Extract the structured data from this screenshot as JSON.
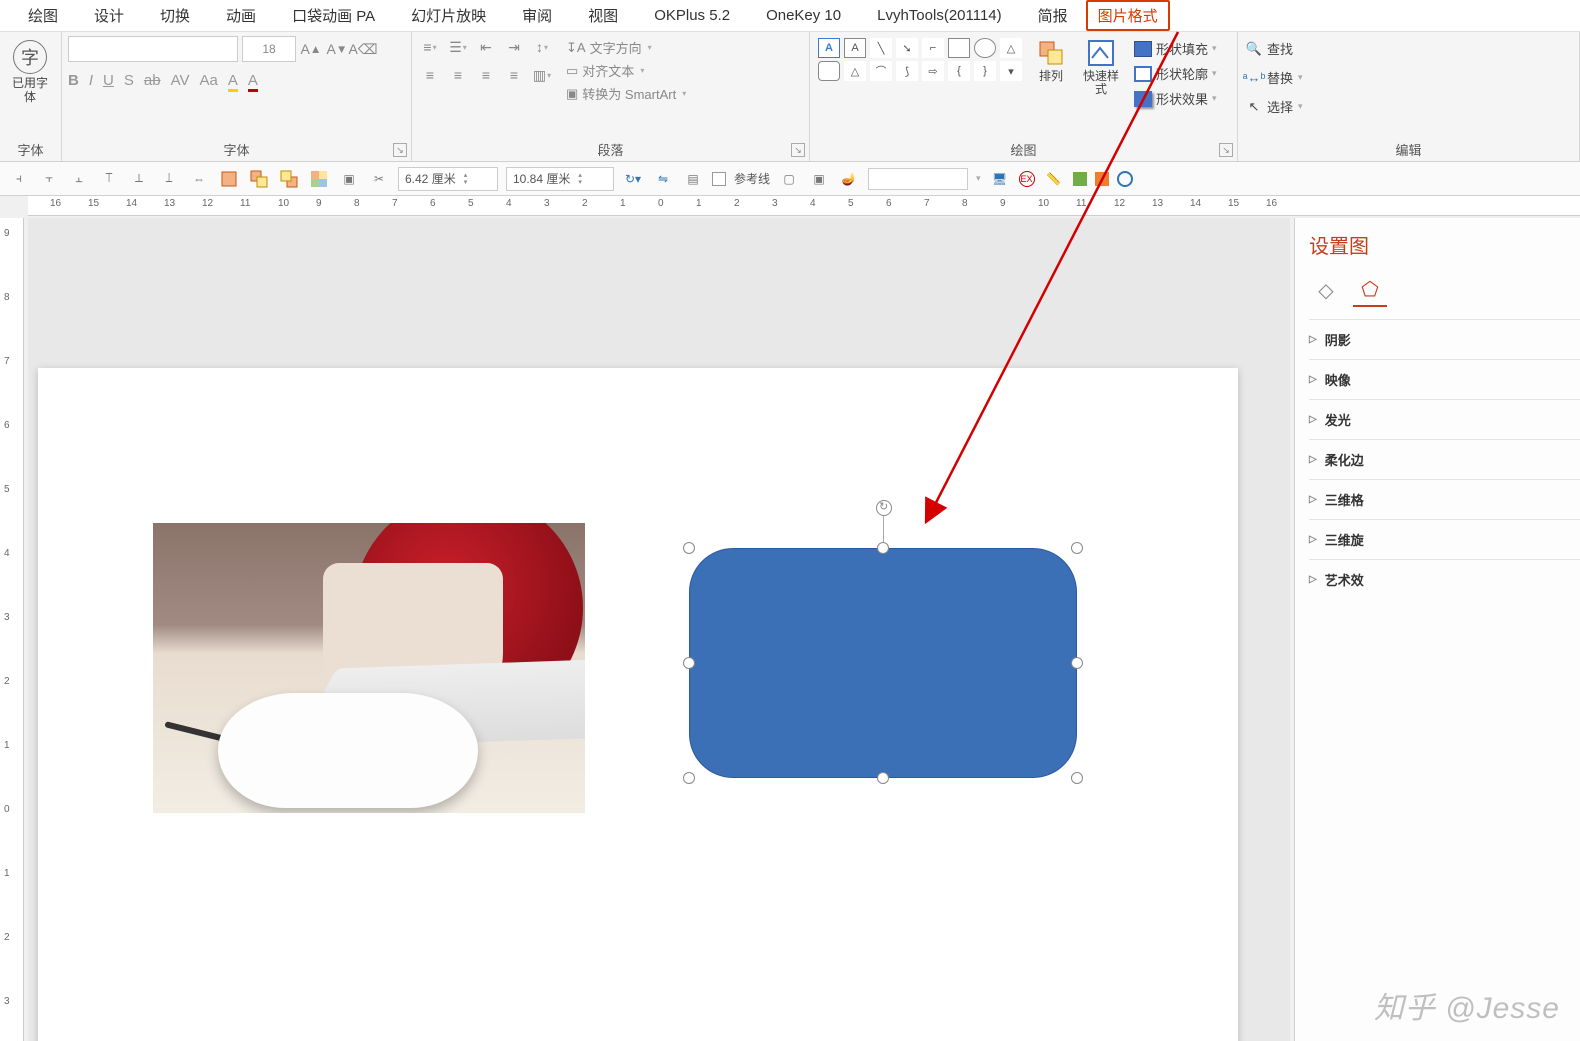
{
  "tabs": {
    "items": [
      "绘图",
      "设计",
      "切换",
      "动画",
      "口袋动画 PA",
      "幻灯片放映",
      "审阅",
      "视图",
      "OKPlus 5.2",
      "OneKey 10",
      "LvyhTools(201114)",
      "简报"
    ],
    "highlighted": "图片格式"
  },
  "ribbon": {
    "group_font_used": {
      "label": "字体",
      "button": "已用字\n体"
    },
    "group_font": {
      "label": "字体",
      "size_placeholder": "18",
      "buttons_row1": [
        "A▲",
        "A▼",
        "Aₐ"
      ],
      "buttons_row2": [
        "B",
        "I",
        "U",
        "S",
        "ab",
        "AV",
        "Aa",
        "A◢",
        "A◢"
      ]
    },
    "group_paragraph": {
      "label": "段落",
      "text_direction": "文字方向",
      "align_text": "对齐文本",
      "convert_smartart": "转换为 SmartArt"
    },
    "group_drawing": {
      "label": "绘图",
      "arrange": "排列",
      "quick_style": "快速样式",
      "shape_fill": "形状填充",
      "shape_outline": "形状轮廓",
      "shape_effects": "形状效果"
    },
    "group_edit": {
      "label": "编辑",
      "find": "查找",
      "replace": "替换",
      "select": "选择"
    }
  },
  "toolbar2": {
    "width": "6.42 厘米",
    "height": "10.84 厘米",
    "guides": "参考线"
  },
  "ruler": {
    "h": [
      "16",
      "15",
      "14",
      "13",
      "12",
      "11",
      "10",
      "9",
      "8",
      "7",
      "6",
      "5",
      "4",
      "3",
      "2",
      "1",
      "0",
      "1",
      "2",
      "3",
      "4",
      "5",
      "6",
      "7",
      "8",
      "9",
      "10",
      "11",
      "12",
      "13",
      "14",
      "15",
      "16"
    ],
    "v": [
      "9",
      "8",
      "7",
      "6",
      "5",
      "4",
      "3",
      "2",
      "1",
      "0",
      "1",
      "2",
      "3"
    ]
  },
  "format_pane": {
    "title": "设置图",
    "sections": [
      "阴影",
      "映像",
      "发光",
      "柔化边",
      "三维格",
      "三维旋",
      "艺术效"
    ]
  },
  "watermark": "知乎 @Jesse",
  "chart_data": null
}
